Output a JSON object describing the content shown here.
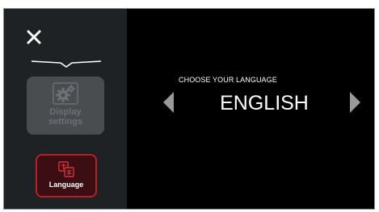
{
  "sidebar": {
    "close_icon": "close-icon",
    "tiles": [
      {
        "label_line1": "Display",
        "label_line2": "settings",
        "icon": "gear-icon",
        "state": "disabled"
      },
      {
        "label": "Language",
        "icon": "language-icon",
        "state": "selected"
      }
    ]
  },
  "main": {
    "prompt": "CHOOSE YOUR LANGUAGE",
    "current_language": "ENGLISH",
    "prev_icon": "chevron-left-icon",
    "next_icon": "chevron-right-icon"
  },
  "colors": {
    "background": "#000000",
    "sidebar": "#1f2224",
    "accent_red": "#b61e2a",
    "disabled_tile": "#4a4d50",
    "arrow": "#9a9a9a"
  }
}
